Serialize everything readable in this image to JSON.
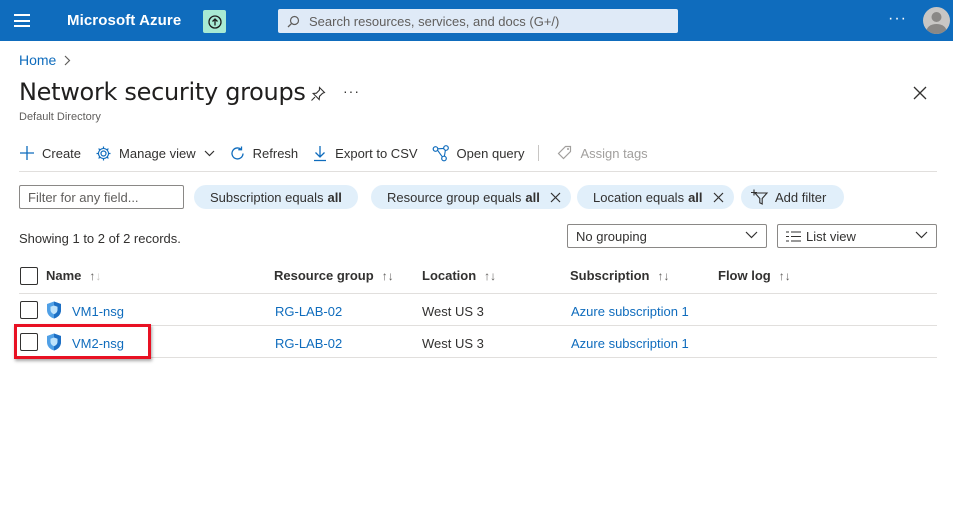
{
  "topbar": {
    "brand": "Microsoft Azure",
    "search_placeholder": "Search resources, services, and docs (G+/)",
    "more_label": "···"
  },
  "breadcrumb": {
    "home": "Home",
    "separator": ">"
  },
  "page": {
    "title": "Network security groups",
    "subtitle": "Default Directory",
    "more_label": "···"
  },
  "toolbar": {
    "create": "Create",
    "manage_view": "Manage view",
    "refresh": "Refresh",
    "export_csv": "Export to CSV",
    "open_query": "Open query",
    "assign_tags": "Assign tags"
  },
  "filters": {
    "input_placeholder": "Filter for any field...",
    "subscription": {
      "label": "Subscription equals",
      "value": "all"
    },
    "resource_group": {
      "label": "Resource group equals",
      "value": "all"
    },
    "location": {
      "label": "Location equals",
      "value": "all"
    },
    "add_filter": "Add filter"
  },
  "records_text": "Showing 1 to 2 of 2 records.",
  "grouping": {
    "selected": "No grouping"
  },
  "view": {
    "selected": "List view"
  },
  "table": {
    "columns": [
      "Name",
      "Resource group",
      "Location",
      "Subscription",
      "Flow log"
    ],
    "rows": [
      {
        "name": "VM1-nsg",
        "resource_group": "RG-LAB-02",
        "location": "West US 3",
        "subscription": "Azure subscription 1",
        "flow_log": ""
      },
      {
        "name": "VM2-nsg",
        "resource_group": "RG-LAB-02",
        "location": "West US 3",
        "subscription": "Azure subscription 1",
        "flow_log": ""
      }
    ]
  },
  "colors": {
    "header_bg": "#0f6cbd",
    "link": "#0f6cbd",
    "pill_bg": "#e1effa",
    "highlight": "#e81123"
  }
}
